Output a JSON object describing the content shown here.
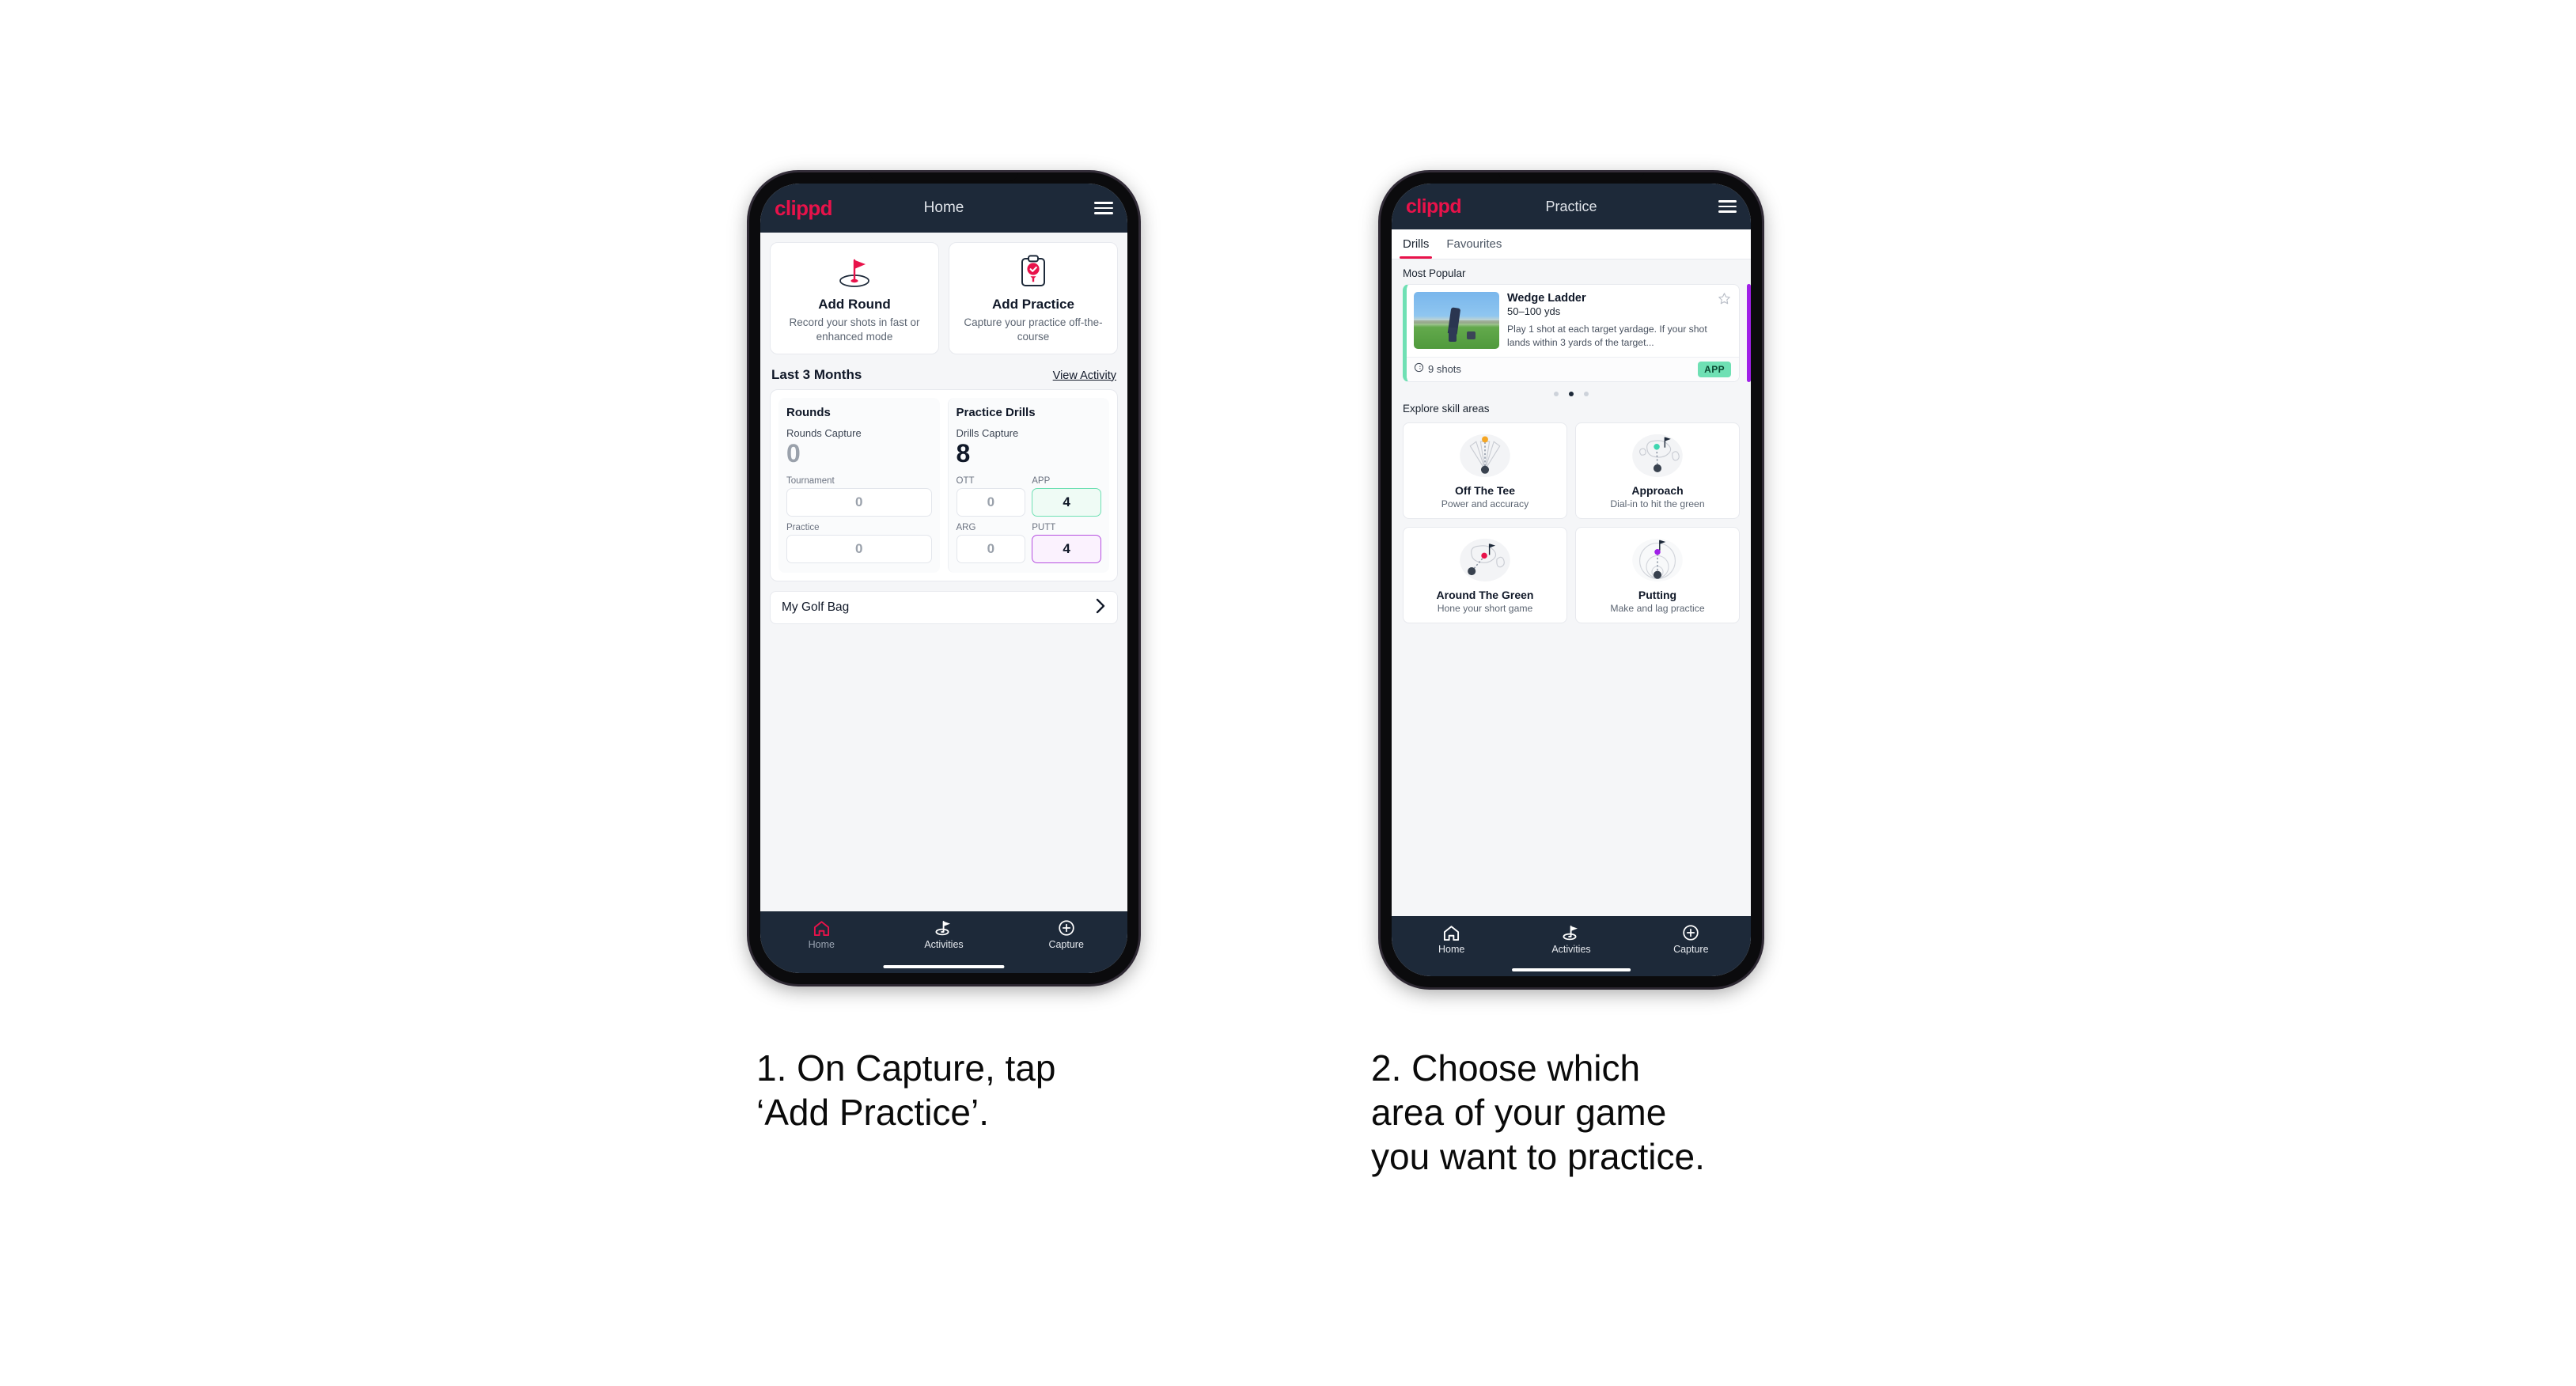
{
  "brand": "clippd",
  "phone_one": {
    "header": {
      "brand": "clippd",
      "title": "Home",
      "menu_icon": "hamburger-menu-icon"
    },
    "actions": [
      {
        "icon": "golf-flag-hole-icon",
        "title": "Add Round",
        "subtitle": "Record your shots in fast or enhanced mode"
      },
      {
        "icon": "clipboard-check-tee-icon",
        "title": "Add Practice",
        "subtitle": "Capture your practice off-the-course"
      }
    ],
    "section": {
      "title": "Last 3 Months",
      "link": "View Activity"
    },
    "stats": {
      "rounds": {
        "title": "Rounds",
        "capture_label": "Rounds Capture",
        "capture_value": "0",
        "fields": [
          {
            "label": "Tournament",
            "value": "0",
            "state": "empty"
          },
          {
            "label": "Practice",
            "value": "0",
            "state": "empty"
          }
        ]
      },
      "drills": {
        "title": "Practice Drills",
        "capture_label": "Drills Capture",
        "capture_value": "8",
        "fields": [
          {
            "label": "OTT",
            "value": "0",
            "state": "empty"
          },
          {
            "label": "APP",
            "value": "4",
            "state": "app"
          },
          {
            "label": "ARG",
            "value": "0",
            "state": "empty"
          },
          {
            "label": "PUTT",
            "value": "4",
            "state": "putt"
          }
        ]
      }
    },
    "golf_bag": {
      "label": "My Golf Bag",
      "chevron": "chevron-right-icon"
    },
    "bottom_nav": [
      {
        "icon": "home-icon",
        "label": "Home",
        "active": true
      },
      {
        "icon": "golf-flag-icon",
        "label": "Activities",
        "active": false
      },
      {
        "icon": "plus-circle-icon",
        "label": "Capture",
        "active": false
      }
    ]
  },
  "phone_two": {
    "header": {
      "brand": "clippd",
      "title": "Practice",
      "menu_icon": "hamburger-menu-icon"
    },
    "tabs": [
      {
        "label": "Drills",
        "active": true
      },
      {
        "label": "Favourites",
        "active": false
      }
    ],
    "most_popular_label": "Most Popular",
    "drill_card": {
      "name": "Wedge Ladder",
      "range": "50–100 yds",
      "description": "Play 1 shot at each target yardage. If your shot lands within 3 yards of the target...",
      "shots": "9 shots",
      "shots_icon": "clock-icon",
      "badge": "APP",
      "badge_color": "#6fe0b4",
      "accent_color": "#6fe0b4",
      "next_card_accent": "#a020e8",
      "favourite_icon": "star-outline-icon",
      "thumbnail": "golfer-practice-photo"
    },
    "carousel_dots": {
      "count": 3,
      "active_index": 1
    },
    "explore_label": "Explore skill areas",
    "skill_areas": [
      {
        "icon": "off-the-tee-icon",
        "title": "Off The Tee",
        "subtitle": "Power and accuracy",
        "dot_color": "#f5a623"
      },
      {
        "icon": "approach-icon",
        "title": "Approach",
        "subtitle": "Dial-in to hit the green",
        "dot_color": "#3fd6b0"
      },
      {
        "icon": "around-the-green-icon",
        "title": "Around The Green",
        "subtitle": "Hone your short game",
        "dot_color": "#e8124a"
      },
      {
        "icon": "putting-icon",
        "title": "Putting",
        "subtitle": "Make and lag practice",
        "dot_color": "#a020e8"
      }
    ],
    "bottom_nav": [
      {
        "icon": "home-icon",
        "label": "Home",
        "active": false
      },
      {
        "icon": "golf-flag-icon",
        "label": "Activities",
        "active": false
      },
      {
        "icon": "plus-circle-icon",
        "label": "Capture",
        "active": false
      }
    ]
  },
  "captions": {
    "step_one": "1. On Capture, tap\n‘Add Practice’.",
    "step_two": "2. Choose which\narea of your game\nyou want to practice."
  }
}
